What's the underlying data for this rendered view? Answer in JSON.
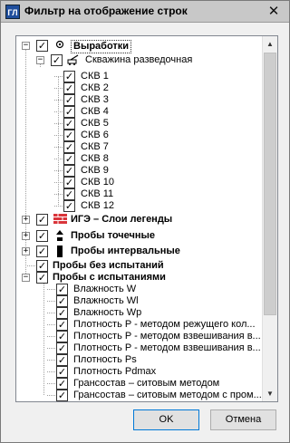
{
  "window": {
    "title": "Фильтр на отображение строк",
    "app_icon_text": "ГЛ"
  },
  "tree": [
    {
      "label": "Выработки",
      "bold": true,
      "checked": true,
      "expander": "−",
      "icon": "target-icon",
      "selected": true
    },
    {
      "label": "Скважина разведочная",
      "bold": false,
      "checked": true,
      "expander": "−",
      "icon": "drill-rig-icon"
    },
    {
      "label": "СКВ 1",
      "checked": true
    },
    {
      "label": "СКВ 2",
      "checked": true
    },
    {
      "label": "СКВ 3",
      "checked": true
    },
    {
      "label": "СКВ 4",
      "checked": true
    },
    {
      "label": "СКВ 5",
      "checked": true
    },
    {
      "label": "СКВ 6",
      "checked": true
    },
    {
      "label": "СКВ 7",
      "checked": true
    },
    {
      "label": "СКВ 8",
      "checked": true
    },
    {
      "label": "СКВ 9",
      "checked": true
    },
    {
      "label": "СКВ 10",
      "checked": true
    },
    {
      "label": "СКВ 11",
      "checked": true
    },
    {
      "label": "СКВ 12",
      "checked": true
    },
    {
      "label": "ИГЭ – Слои легенды",
      "bold": true,
      "checked": true,
      "expander": "+",
      "icon": "legend-layers-icon"
    },
    {
      "label": "Пробы точечные",
      "bold": true,
      "checked": true,
      "expander": "+",
      "icon": "point-sample-icon"
    },
    {
      "label": "Пробы интервальные",
      "bold": true,
      "checked": true,
      "expander": "+",
      "icon": "interval-sample-icon"
    },
    {
      "label": "Пробы без испытаний",
      "bold": true,
      "checked": true
    },
    {
      "label": "Пробы с испытаниями",
      "bold": true,
      "checked": true,
      "expander": "−"
    },
    {
      "label": "Влажность W",
      "checked": true
    },
    {
      "label": "Влажность Wl",
      "checked": true
    },
    {
      "label": "Влажность Wp",
      "checked": true
    },
    {
      "label": "Плотность P - методом режущего кол...",
      "checked": true
    },
    {
      "label": "Плотность P - методом взвешивания в...",
      "checked": true
    },
    {
      "label": "Плотность P - методом взвешивания в...",
      "checked": true
    },
    {
      "label": "Плотность Ps",
      "checked": true
    },
    {
      "label": "Плотность Pdmax",
      "checked": true
    },
    {
      "label": "Грансостав – ситовым методом",
      "checked": true
    },
    {
      "label": "Грансостав – ситовым методом с пром...",
      "checked": true
    }
  ],
  "check_mark": "✓",
  "scrollbar": {
    "up_arrow": "▲",
    "down_arrow": "▼"
  },
  "buttons": {
    "ok": "OK",
    "cancel": "Отмена"
  },
  "close_glyph": "✕",
  "colors": {
    "legend_icon": "#d9343a",
    "titlebar": "#c8c8c8",
    "ok_border": "#0078d7"
  }
}
